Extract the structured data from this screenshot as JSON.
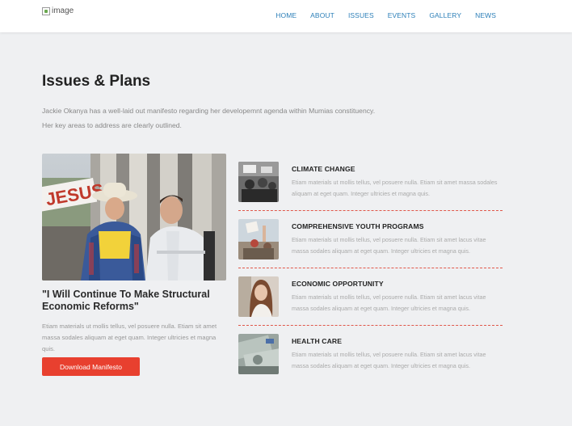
{
  "header": {
    "logo_alt": "image",
    "nav": [
      "HOME",
      "ABOUT",
      "ISSUES",
      "EVENTS",
      "GALLERY",
      "NEWS"
    ]
  },
  "section": {
    "title": "Issues & Plans",
    "intro_line1": "Jackie Okanya has a well-laid out manifesto regarding her developemnt agenda within Mumias constituency.",
    "intro_line2": "Her key areas to address are clearly outlined."
  },
  "feature": {
    "sign_text": "JESUS",
    "quote": "\"I Will Continue To Make Structural Economic Reforms\"",
    "body": "Etiam materials ut mollis tellus, vel posuere nulla. Etiam sit amet massa sodales aliquam at eget quam. Integer ultricies et magna quis.",
    "button_label": "Download Manifesto"
  },
  "issues": [
    {
      "title": "CLIMATE CHANGE",
      "body": "Etiam materials ut mollis tellus, vel posuere nulla. Etiam sit amet massa sodales aliquam at eget quam. Integer ultricies et magna quis."
    },
    {
      "title": "COMPREHENSIVE YOUTH PROGRAMS",
      "body": "Etiam materials ut mollis tellus, vel posuere nulla. Etiam sit amet lacus vitae massa sodales aliquam at eget quam. Integer ultricies et magna quis."
    },
    {
      "title": "ECONOMIC OPPORTUNITY",
      "body": "Etiam materials ut mollis tellus, vel posuere nulla. Etiam sit amet lacus vitae massa sodales aliquam at eget quam. Integer ultricies et magna quis."
    },
    {
      "title": "HEALTH CARE",
      "body": "Etiam materials ut mollis tellus, vel posuere nulla. Etiam sit amet lacus vitae massa sodales aliquam at eget quam. Integer ultricies et magna quis."
    }
  ],
  "colors": {
    "accent": "#e8402f",
    "nav_link": "#2c7fb8",
    "background": "#eff0f2"
  }
}
